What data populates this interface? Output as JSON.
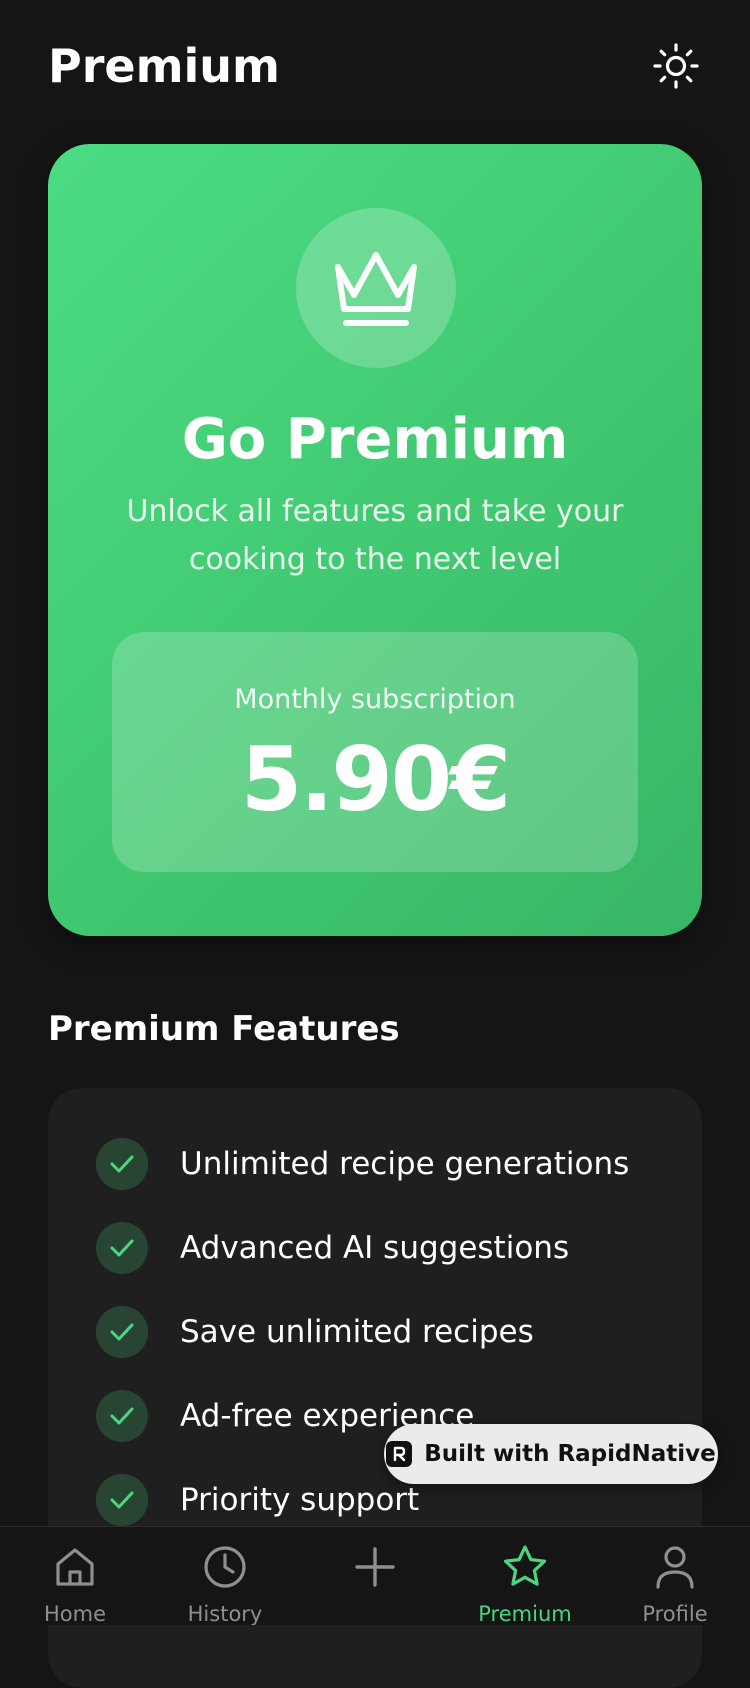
{
  "header": {
    "title": "Premium",
    "theme_icon": "sun-icon"
  },
  "hero": {
    "icon": "crown-icon",
    "title": "Go Premium",
    "subtitle": "Unlock all features and take your cooking to the next level",
    "price_label": "Monthly subscription",
    "price_value": "5.90€"
  },
  "features": {
    "heading": "Premium Features",
    "items": [
      "Unlimited recipe generations",
      "Advanced AI suggestions",
      "Save unlimited recipes",
      "Ad-free experience",
      "Priority support"
    ]
  },
  "badge": {
    "text": "Built with RapidNative"
  },
  "tabs": [
    {
      "label": "Home",
      "icon": "home-icon"
    },
    {
      "label": "History",
      "icon": "clock-icon"
    },
    {
      "label": "",
      "icon": "plus-icon"
    },
    {
      "label": "Premium",
      "icon": "star-icon"
    },
    {
      "label": "Profile",
      "icon": "user-icon"
    }
  ],
  "active_tab": "Premium",
  "colors": {
    "accent": "#4cd580",
    "background": "#151516",
    "card": "#1f1f20",
    "tab_inactive": "#8e8e93"
  }
}
